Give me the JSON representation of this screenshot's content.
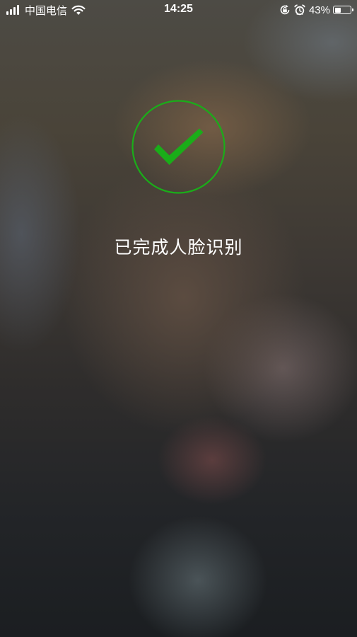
{
  "status_bar": {
    "carrier": "中国电信",
    "time": "14:25",
    "battery_percent": "43%",
    "battery_level": 0.43,
    "icons": [
      "signal-icon",
      "wifi-icon",
      "orientation-lock-icon",
      "alarm-icon",
      "battery-icon"
    ]
  },
  "result": {
    "icon": "checkmark-circle-icon",
    "message": "已完成人脸识别",
    "accent_color": "#1aad19"
  }
}
